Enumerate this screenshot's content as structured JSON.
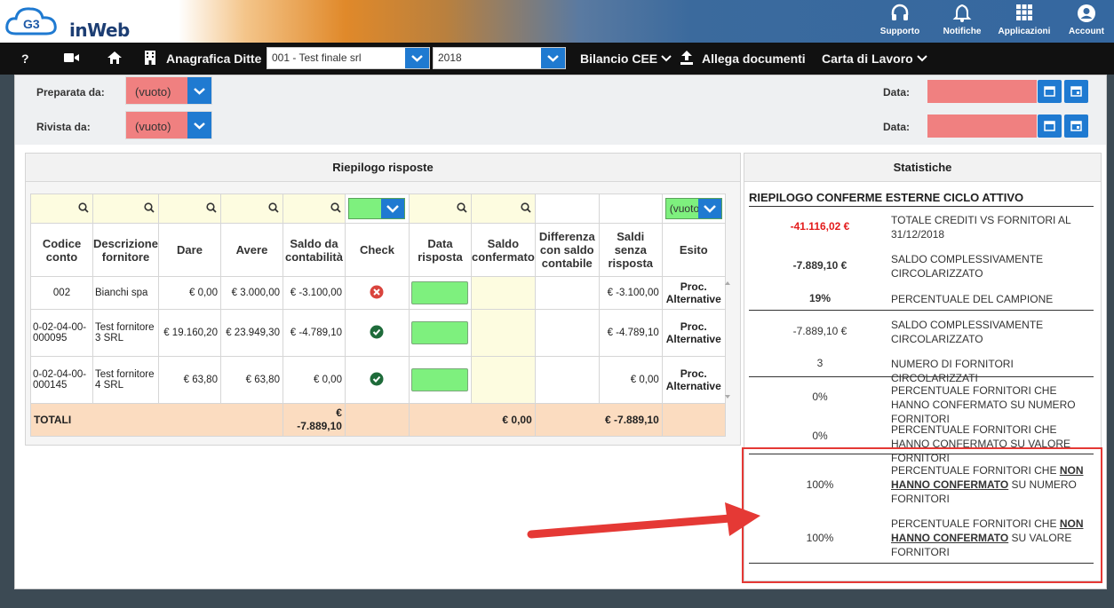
{
  "header": {
    "logo_mark": "G3",
    "app_name": "inWeb",
    "nav": [
      {
        "label": "Supporto",
        "icon": "headset-icon"
      },
      {
        "label": "Notifiche",
        "icon": "bell-icon"
      },
      {
        "label": "Applicazioni",
        "icon": "grid-icon"
      },
      {
        "label": "Account",
        "icon": "user-icon"
      }
    ]
  },
  "menubar": {
    "help": "?",
    "anagrafica": "Anagrafica Ditte",
    "company_select": "001 - Test finale srl",
    "year_select": "2018",
    "bilancio": "Bilancio CEE",
    "allega": "Allega documenti",
    "carta": "Carta di Lavoro"
  },
  "form": {
    "preparata_label": "Preparata da:",
    "preparata_value": "(vuoto)",
    "rivista_label": "Rivista da:",
    "rivista_value": "(vuoto)",
    "data_label_1": "Data:",
    "data_label_2": "Data:"
  },
  "riepilogo": {
    "title": "Riepilogo risposte",
    "esito_filter": "(vuoto)",
    "headers": [
      "Codice conto",
      "Descrizione fornitore",
      "Dare",
      "Avere",
      "Saldo da contabilità",
      "Check",
      "Data risposta",
      "Saldo confermato",
      "Differenza con saldo contabile",
      "Saldi senza risposta",
      "Esito"
    ],
    "rows": [
      {
        "codice": "002",
        "descrizione": "Bianchi spa",
        "dare": "€ 0,00",
        "avere": "€ 3.000,00",
        "saldo": "€ -3.100,00",
        "check": "error",
        "saldo_senza": "€ -3.100,00",
        "esito": "Proc. Alternative"
      },
      {
        "codice": "0-02-04-00-000095",
        "descrizione": "Test fornitore 3 SRL",
        "dare": "€ 19.160,20",
        "avere": "€ 23.949,30",
        "saldo": "€ -4.789,10",
        "check": "ok",
        "saldo_senza": "€ -4.789,10",
        "esito": "Proc. Alternative"
      },
      {
        "codice": "0-02-04-00-000145",
        "descrizione": "Test fornitore 4 SRL",
        "dare": "€ 63,80",
        "avere": "€ 63,80",
        "saldo": "€ 0,00",
        "check": "ok",
        "saldo_senza": "€ 0,00",
        "esito": "Proc. Alternative"
      }
    ],
    "totals": {
      "label": "TOTALI",
      "saldo_1": "€",
      "saldo_2": "-7.889,10",
      "confermato": "€ 0,00",
      "senza": "€ -7.889,10"
    }
  },
  "statistiche": {
    "title": "Statistiche",
    "section": "RIEPILOGO CONFERME ESTERNE CICLO ATTIVO",
    "items": [
      {
        "value": "-41.116,02 €",
        "desc": "TOTALE CREDITI VS FORNITORI AL 31/12/2018"
      },
      {
        "value": "-7.889,10 €",
        "desc": "SALDO COMPLESSIVAMENTE CIRCOLARIZZATO"
      },
      {
        "value": "19%",
        "desc": "PERCENTUALE DEL CAMPIONE"
      },
      {
        "value": "-7.889,10 €",
        "desc": "SALDO COMPLESSIVAMENTE CIRCOLARIZZATO"
      },
      {
        "value": "3",
        "desc": "NUMERO DI FORNITORI CIRCOLARIZZATI"
      },
      {
        "value": "0%",
        "desc": "PERCENTUALE FORNITORI CHE HANNO CONFERMATO SU NUMERO FORNITORI"
      },
      {
        "value": "0%",
        "desc": "PERCENTUALE FORNITORI CHE HANNO CONFERMATO SU VALORE FORNITORI"
      }
    ],
    "non_items": [
      {
        "value": "100%",
        "pre": "PERCENTUALE FORNITORI CHE ",
        "bold": "NON HANNO CONFERMATO",
        "post": " SU NUMERO FORNITORI"
      },
      {
        "value": "100%",
        "pre": "PERCENTUALE FORNITORI CHE ",
        "bold": "NON HANNO CONFERMATO",
        "post": " SU VALORE FORNITORI"
      }
    ]
  },
  "colors": {
    "accent": "#1f7ad1",
    "negative": "#e31b1b",
    "empty_field": "#f08080",
    "ok_field": "#7ef07e",
    "totals_bg": "#fbdcc0"
  }
}
